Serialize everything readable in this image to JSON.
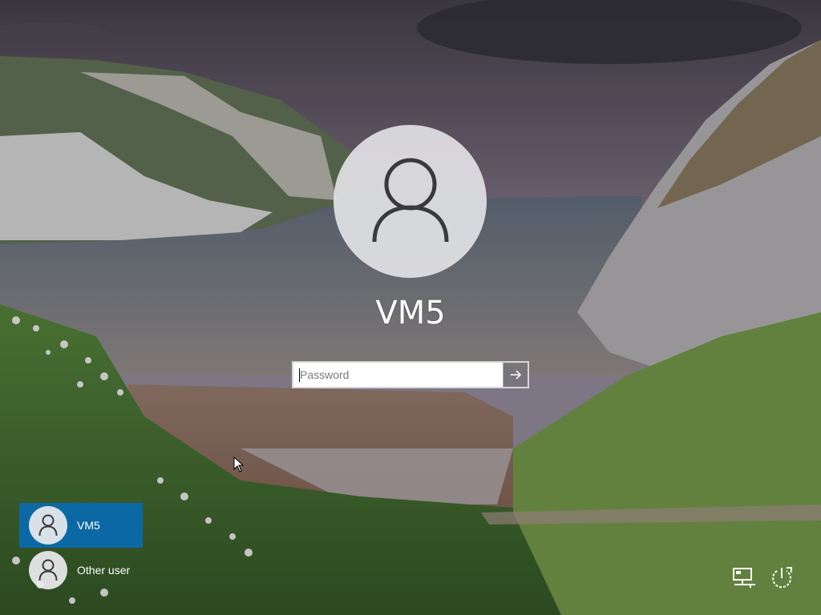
{
  "login": {
    "username": "VM5",
    "password_placeholder": "Password",
    "password_value": ""
  },
  "user_list": [
    {
      "label": "VM5",
      "selected": true
    },
    {
      "label": "Other user",
      "selected": false
    }
  ],
  "icons": {
    "avatar": "user-silhouette-icon",
    "submit": "arrow-right-icon",
    "network": "network-icon",
    "power": "power-icon"
  },
  "colors": {
    "selected_user_bg": "#006ec8",
    "submit_bg": "#78767d"
  }
}
